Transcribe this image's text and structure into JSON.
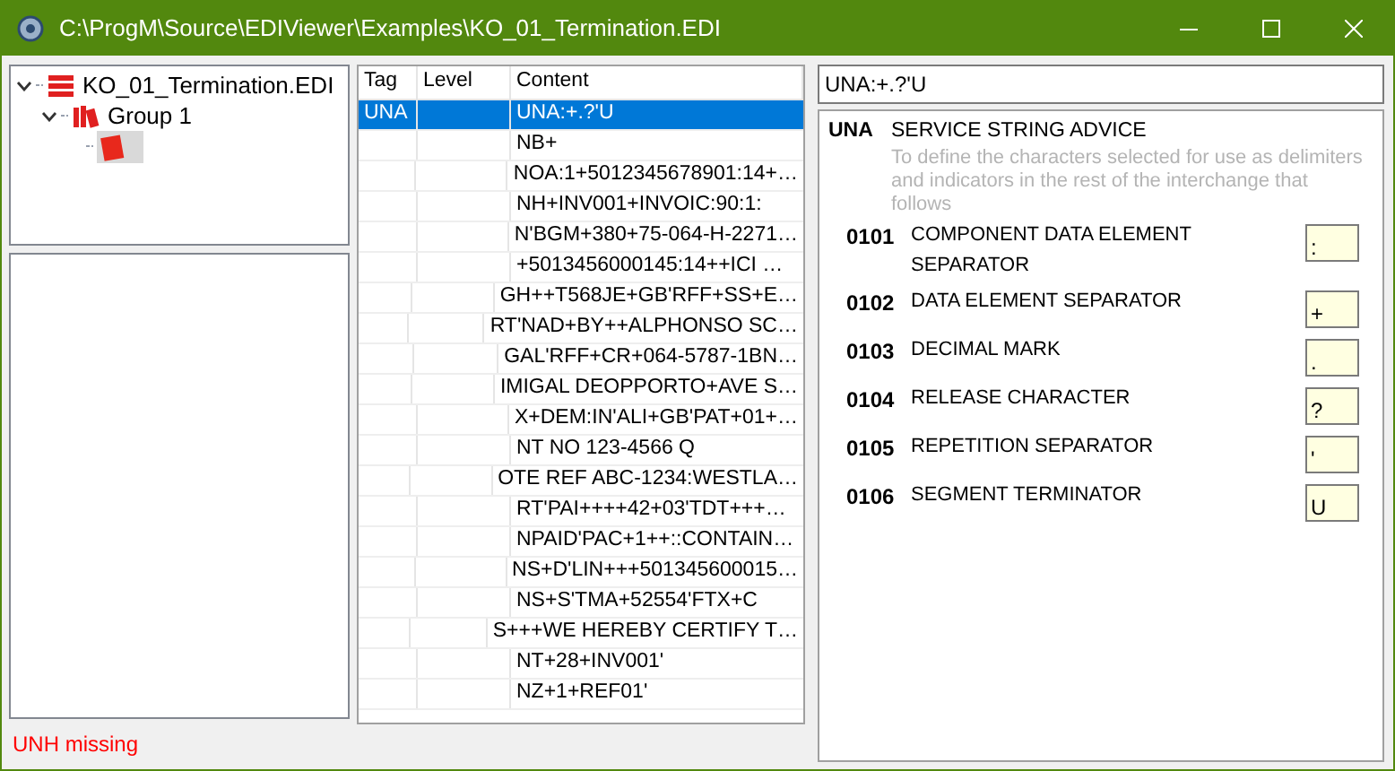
{
  "window": {
    "title": "C:\\ProgM\\Source\\EDIViewer\\Examples\\KO_01_Termination.EDI"
  },
  "tree": [
    {
      "label": "KO_01_Termination.EDI",
      "kind": "file",
      "expanded": true,
      "selected": false,
      "children": [
        {
          "label": "Group 1",
          "kind": "group",
          "expanded": true,
          "selected": false,
          "children": [
            {
              "kind": "item",
              "selected": true
            }
          ]
        }
      ]
    }
  ],
  "table": {
    "columns": [
      "Tag",
      "Level",
      "Content"
    ],
    "rows": [
      {
        "tag": "UNA",
        "content": "UNA:+.?'U",
        "selected": true
      },
      {
        "content": "NB+",
        "selected": false
      },
      {
        "content": "NOA:1+5012345678901:14+…",
        "selected": false
      },
      {
        "content": "NH+INV001+INVOIC:90:1:",
        "selected": false
      },
      {
        "content": "N'BGM+380+75-064-H-2271…",
        "selected": false
      },
      {
        "content": "+5013456000145:14++ICI …",
        "selected": false
      },
      {
        "content": "GH++T568JE+GB'RFF+SS+E…",
        "selected": false
      },
      {
        "content": "RT'NAD+BY++ALPHONSO SC…",
        "selected": false
      },
      {
        "content": "GAL'RFF+CR+064-5787-1BN…",
        "selected": false
      },
      {
        "content": "IMIGAL DEOPPORTO+AVE S…",
        "selected": false
      },
      {
        "content": "X+DEM:IN'ALI+GB'PAT+01+…",
        "selected": false
      },
      {
        "content": "NT NO 123-4566 Q",
        "selected": false
      },
      {
        "content": "OTE REF ABC-1234:WESTLA…",
        "selected": false
      },
      {
        "content": "RT'PAI++++42+03'TDT+++…",
        "selected": false
      },
      {
        "content": "NPAID'PAC+1++::CONTAIN…",
        "selected": false
      },
      {
        "content": "NS+D'LIN+++501345600015…",
        "selected": false
      },
      {
        "content": "NS+S'TMA+52554'FTX+C",
        "selected": false
      },
      {
        "content": "S+++WE HEREBY CERTIFY T…",
        "selected": false
      },
      {
        "content": "NT+28+INV001'",
        "selected": false
      },
      {
        "content": "NZ+1+REF01'",
        "selected": false
      }
    ]
  },
  "status": "UNH missing",
  "segment_field": {
    "value": "UNA:+.?'U"
  },
  "segment": {
    "tag": "UNA",
    "name": "SERVICE STRING ADVICE",
    "description": "To define the characters selected for use as delimiters and indicators in the rest of the interchange that follows",
    "elements": [
      {
        "code": "0101",
        "name": "COMPONENT DATA ELEMENT SEPARATOR",
        "value": ":"
      },
      {
        "code": "0102",
        "name": "DATA ELEMENT SEPARATOR",
        "value": "+"
      },
      {
        "code": "0103",
        "name": "DECIMAL MARK",
        "value": "."
      },
      {
        "code": "0104",
        "name": "RELEASE CHARACTER",
        "value": "?"
      },
      {
        "code": "0105",
        "name": "REPETITION SEPARATOR",
        "value": "'"
      },
      {
        "code": "0106",
        "name": "SEGMENT TERMINATOR",
        "value": "U"
      }
    ]
  }
}
